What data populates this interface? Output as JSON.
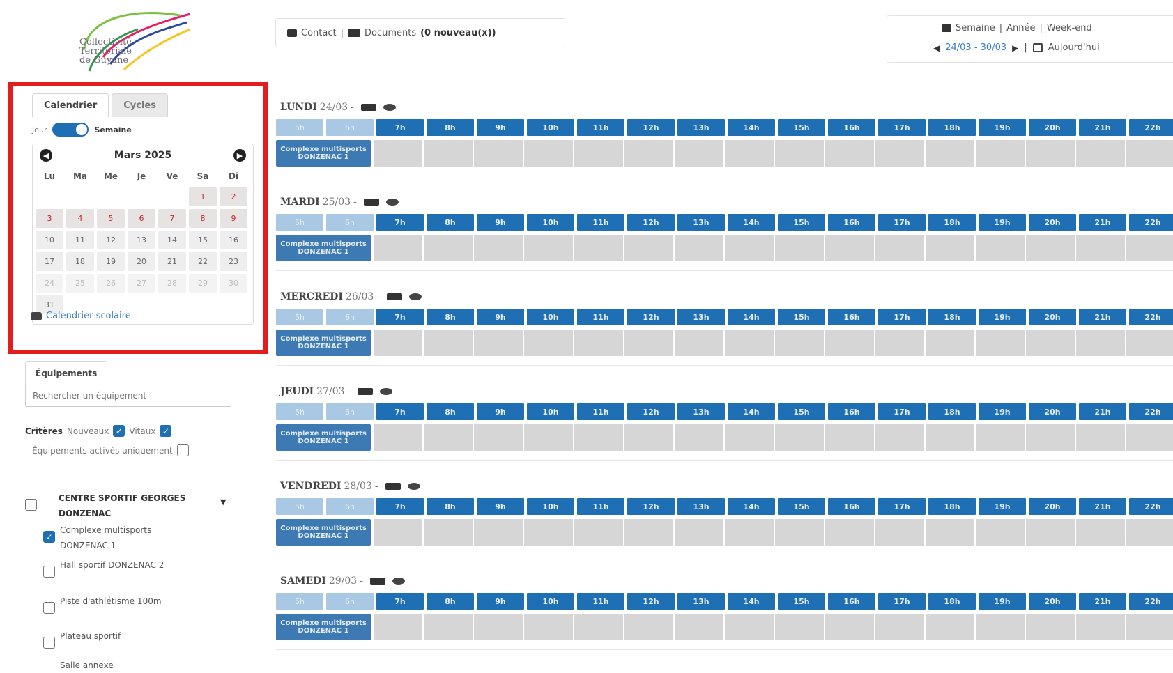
{
  "logo": {
    "line1": "Collectivité",
    "line2": "Territoriale",
    "line3": "de Guyane"
  },
  "tabs": {
    "calendar": "Calendrier",
    "cycles": "Cycles"
  },
  "toggle": {
    "left": "Jour",
    "right": "Semaine"
  },
  "datepicker": {
    "month": "Mars 2025",
    "prev": "◀",
    "next": "▶",
    "dow": [
      "Lu",
      "Ma",
      "Me",
      "Je",
      "Ve",
      "Sa",
      "Di"
    ],
    "cells": [
      {
        "t": "",
        "s": "empty"
      },
      {
        "t": "",
        "s": "empty"
      },
      {
        "t": "",
        "s": "empty"
      },
      {
        "t": "",
        "s": "empty"
      },
      {
        "t": "",
        "s": "empty"
      },
      {
        "t": "1",
        "s": "red"
      },
      {
        "t": "2",
        "s": "red"
      },
      {
        "t": "3",
        "s": "red"
      },
      {
        "t": "4",
        "s": "red"
      },
      {
        "t": "5",
        "s": "red"
      },
      {
        "t": "6",
        "s": "red"
      },
      {
        "t": "7",
        "s": "red"
      },
      {
        "t": "8",
        "s": "red"
      },
      {
        "t": "9",
        "s": "red"
      },
      {
        "t": "10",
        "s": "norm"
      },
      {
        "t": "11",
        "s": "norm"
      },
      {
        "t": "12",
        "s": "norm"
      },
      {
        "t": "13",
        "s": "norm"
      },
      {
        "t": "14",
        "s": "norm"
      },
      {
        "t": "15",
        "s": "norm"
      },
      {
        "t": "16",
        "s": "norm"
      },
      {
        "t": "17",
        "s": "norm"
      },
      {
        "t": "18",
        "s": "norm"
      },
      {
        "t": "19",
        "s": "norm"
      },
      {
        "t": "20",
        "s": "norm"
      },
      {
        "t": "21",
        "s": "norm"
      },
      {
        "t": "22",
        "s": "norm"
      },
      {
        "t": "23",
        "s": "norm"
      },
      {
        "t": "24",
        "s": "faded"
      },
      {
        "t": "25",
        "s": "faded"
      },
      {
        "t": "26",
        "s": "faded"
      },
      {
        "t": "27",
        "s": "faded"
      },
      {
        "t": "28",
        "s": "faded"
      },
      {
        "t": "29",
        "s": "faded"
      },
      {
        "t": "30",
        "s": "faded"
      },
      {
        "t": "31",
        "s": "norm"
      }
    ]
  },
  "calendar_link": "Calendrier scolaire",
  "equipments": {
    "tab": "Équipements",
    "search_placeholder": "Rechercher un équipement",
    "criteria_label": "Critères",
    "criteria_a": "Nouveaux",
    "criteria_b": "Vitaux",
    "active_only": "Équipements activés uniquement"
  },
  "tree": {
    "parent": "CENTRE SPORTIF GEORGES DONZENAC",
    "caret": "▼",
    "children": [
      {
        "label": "Complexe multisports DONZENAC 1",
        "checked": true
      },
      {
        "label": "Hall sportif DONZENAC 2",
        "checked": false
      },
      {
        "label": "Piste d'athlétisme 100m",
        "checked": false
      },
      {
        "label": "Plateau sportif",
        "checked": false
      },
      {
        "label": "Salle annexe",
        "checked": false
      }
    ]
  },
  "topnav": {
    "contact": "Contact",
    "sep": "|",
    "documents": "Documents",
    "documents_count": "(0 nouveau(x))"
  },
  "view": {
    "semaine": "Semaine",
    "annee": "Année",
    "weekend": "Week-end",
    "sep": "|",
    "range": "24/03 - 30/03",
    "today": "Aujourd'hui"
  },
  "hours": [
    "5h",
    "6h",
    "7h",
    "8h",
    "9h",
    "10h",
    "11h",
    "12h",
    "13h",
    "14h",
    "15h",
    "16h",
    "17h",
    "18h",
    "19h",
    "20h",
    "21h",
    "22h"
  ],
  "room_label": "Complexe multisports DONZENAC 1",
  "days": [
    {
      "name": "LUNDI",
      "date": "24/03",
      "dash": "-"
    },
    {
      "name": "MARDI",
      "date": "25/03",
      "dash": "-"
    },
    {
      "name": "MERCREDI",
      "date": "26/03",
      "dash": "-"
    },
    {
      "name": "JEUDI",
      "date": "27/03",
      "dash": "-"
    },
    {
      "name": "VENDREDI",
      "date": "28/03",
      "dash": "-"
    },
    {
      "name": "SAMEDI",
      "date": "29/03",
      "dash": "-"
    }
  ],
  "colors": {
    "accent": "#1f6fb4",
    "highlight_border": "#e11d1d",
    "today_line": "#f6b34a"
  }
}
